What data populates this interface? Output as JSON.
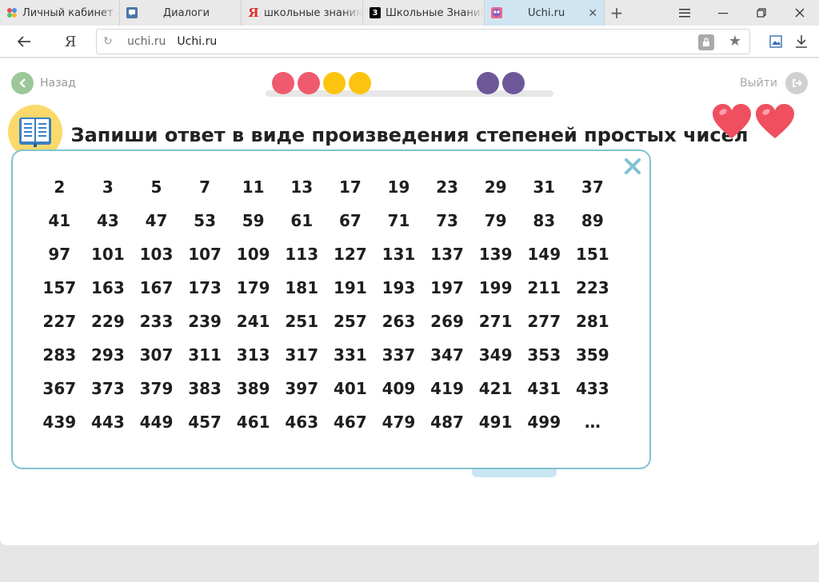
{
  "browser": {
    "tabs": [
      {
        "label": "Личный кабинет - I",
        "favicon": "multicolor-dots-icon"
      },
      {
        "label": "Диалоги",
        "favicon": "chat-bubble-icon"
      },
      {
        "label": "школьные знания -",
        "favicon": "yandex-y-icon"
      },
      {
        "label": "Школьные Знания.",
        "favicon": "znanija-3-icon"
      },
      {
        "label": "Uchi.ru",
        "favicon": "uchi-owl-icon",
        "active": true
      }
    ],
    "new_tab_symbol": "+",
    "yandex_symbol": "Я",
    "url_domain": "uchi.ru",
    "url_title": "Uchi.ru"
  },
  "header": {
    "back_label": "Назад",
    "exit_label": "Выйти"
  },
  "progress": {
    "dots": [
      "#ef5b6e",
      "#ef5b6e",
      "#fcc40e",
      "#fcc40e",
      null,
      null,
      null,
      null,
      "#6e5799",
      "#6e5799"
    ]
  },
  "lives": 2,
  "task": {
    "title": "Запиши ответ в виде произведения степеней простых чисел"
  },
  "primes_panel": {
    "numbers": [
      "2",
      "3",
      "5",
      "7",
      "11",
      "13",
      "17",
      "19",
      "23",
      "29",
      "31",
      "37",
      "41",
      "43",
      "47",
      "53",
      "59",
      "61",
      "67",
      "71",
      "73",
      "79",
      "83",
      "89",
      "97",
      "101",
      "103",
      "107",
      "109",
      "113",
      "127",
      "131",
      "137",
      "139",
      "149",
      "151",
      "157",
      "163",
      "167",
      "173",
      "179",
      "181",
      "191",
      "193",
      "197",
      "199",
      "211",
      "223",
      "227",
      "229",
      "233",
      "239",
      "241",
      "251",
      "257",
      "263",
      "269",
      "271",
      "277",
      "281",
      "283",
      "293",
      "307",
      "311",
      "313",
      "317",
      "331",
      "337",
      "347",
      "349",
      "353",
      "359",
      "367",
      "373",
      "379",
      "383",
      "389",
      "397",
      "401",
      "409",
      "419",
      "421",
      "431",
      "433",
      "439",
      "443",
      "449",
      "457",
      "461",
      "463",
      "467",
      "479",
      "487",
      "491",
      "499",
      "…"
    ]
  },
  "colors": {
    "accent_blue": "#7fc2d3",
    "heart_red": "#ef4f5f",
    "back_green": "#9cc79b"
  }
}
